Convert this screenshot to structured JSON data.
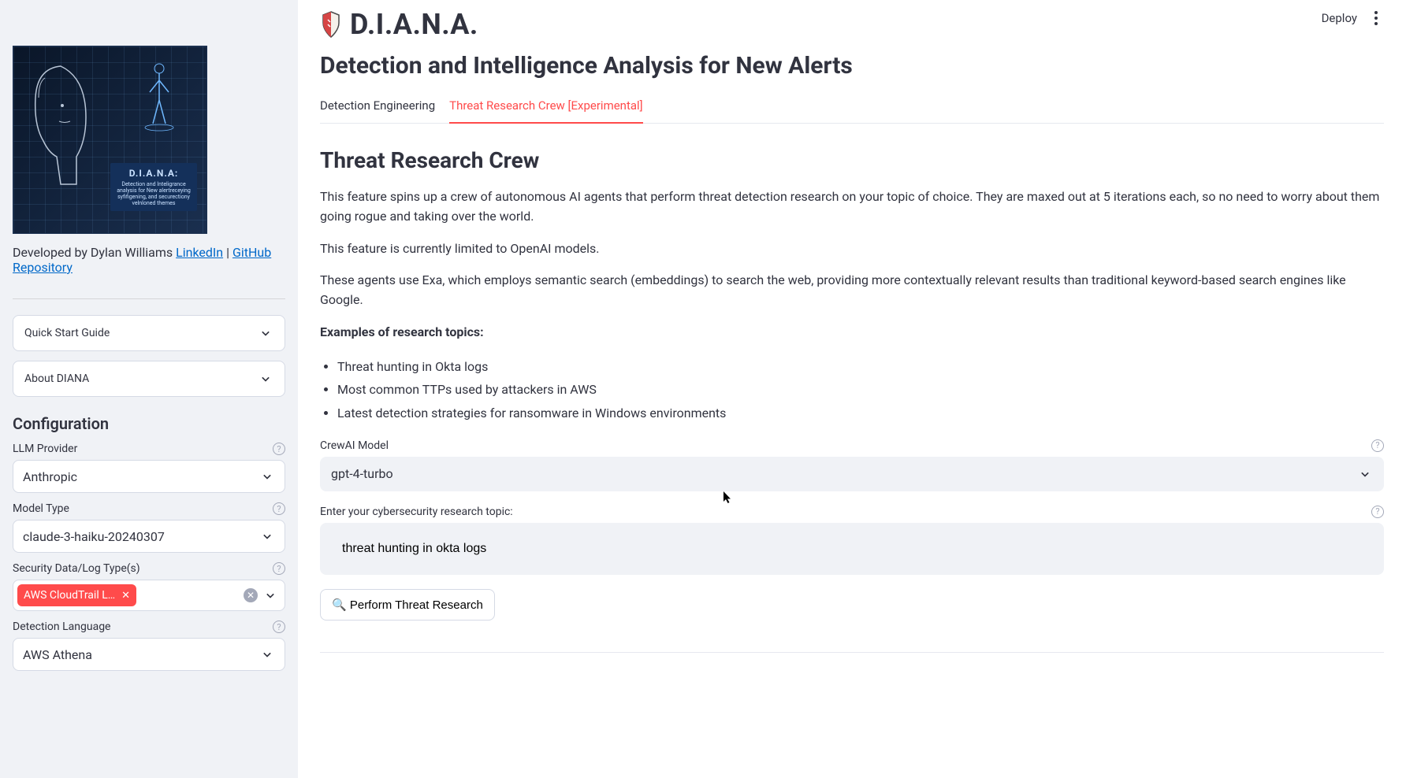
{
  "brand": {
    "name": "D.I.A.N.A."
  },
  "page_title": "Detection and Intelligence Analysis for New Alerts",
  "topbar": {
    "deploy": "Deploy"
  },
  "tabs": {
    "detection_engineering": "Detection Engineering",
    "threat_research": "Threat Research Crew [Experimental]"
  },
  "threat_research": {
    "heading": "Threat Research Crew",
    "p1": "This feature spins up a crew of autonomous AI agents that perform threat detection research on your topic of choice. They are maxed out at 5 iterations each, so no need to worry about them going rogue and taking over the world.",
    "p2": "This feature is currently limited to OpenAI models.",
    "p3": "These agents use Exa, which employs semantic search (embeddings) to search the web, providing more contextually relevant results than traditional keyword-based search engines like Google.",
    "examples_label": "Examples of research topics:",
    "examples": [
      "Threat hunting in Okta logs",
      "Most common TTPs used by attackers in AWS",
      "Latest detection strategies for ransomware in Windows environments"
    ],
    "model_label": "CrewAI Model",
    "model_value": "gpt-4-turbo",
    "topic_label": "Enter your cybersecurity research topic:",
    "topic_value": "threat hunting in okta logs",
    "button": "🔍 Perform Threat Research"
  },
  "sidebar": {
    "hero_card_title": "D.I.A.N.A:",
    "hero_card_sub": "Detection and Inteligrance analysis for New alertreceying syfifigening, and securectiony velnloned themes",
    "credits_prefix": "Developed by Dylan Williams ",
    "linkedin": "LinkedIn",
    "separator": " | ",
    "github": "GitHub Repository",
    "quick_start": "Quick Start Guide",
    "about": "About DIANA",
    "config_heading": "Configuration",
    "llm_provider_label": "LLM Provider",
    "llm_provider_value": "Anthropic",
    "model_type_label": "Model Type",
    "model_type_value": "claude-3-haiku-20240307",
    "log_types_label": "Security Data/Log Type(s)",
    "log_types_tag": "AWS CloudTrail L…",
    "detection_lang_label": "Detection Language",
    "detection_lang_value": "AWS Athena"
  }
}
